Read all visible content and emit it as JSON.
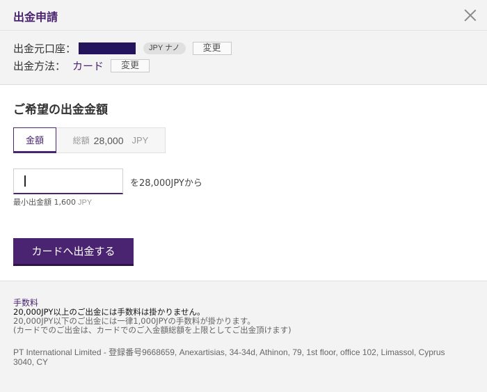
{
  "header": {
    "title": "出金申請",
    "close_icon": "close-icon"
  },
  "account": {
    "source_label": "出金元口座：",
    "currency_badge": "JPY ナノ",
    "change_label": "変更",
    "method_label": "出金方法：",
    "method_value": "カード",
    "method_change_label": "変更"
  },
  "main": {
    "section_title": "ご希望の出金金額",
    "tabs": {
      "amount_label": "金額",
      "total_label": "総額",
      "total_value": "28,000",
      "total_currency": "JPY"
    },
    "amount_input": {
      "value": "",
      "placeholder": ""
    },
    "from_text": "を28,000JPYから",
    "min_label": "最小出金額 1,600",
    "min_currency": "JPY",
    "submit_label": "カードへ出金する"
  },
  "footer": {
    "fee_title": "手数料",
    "fee_lines": [
      "20,000JPY以上のご出金には手数料は掛かりません。",
      "20,000JPY以下のご出金には一律1,000JPYの手数料が掛かります。",
      "(カードでのご出金は、カードでのご入金額総額を上限としてご出金頂けます)"
    ],
    "company": "PT International Limited - 登録番号9668659, Anexartisias, 34-34d, Athinon, 79, 1st floor, office 102, Limassol, Cyprus 3040, CY"
  },
  "colors": {
    "accent": "#4a2470",
    "masked_account": "#24145e",
    "background_gray": "#f3f3f3"
  }
}
